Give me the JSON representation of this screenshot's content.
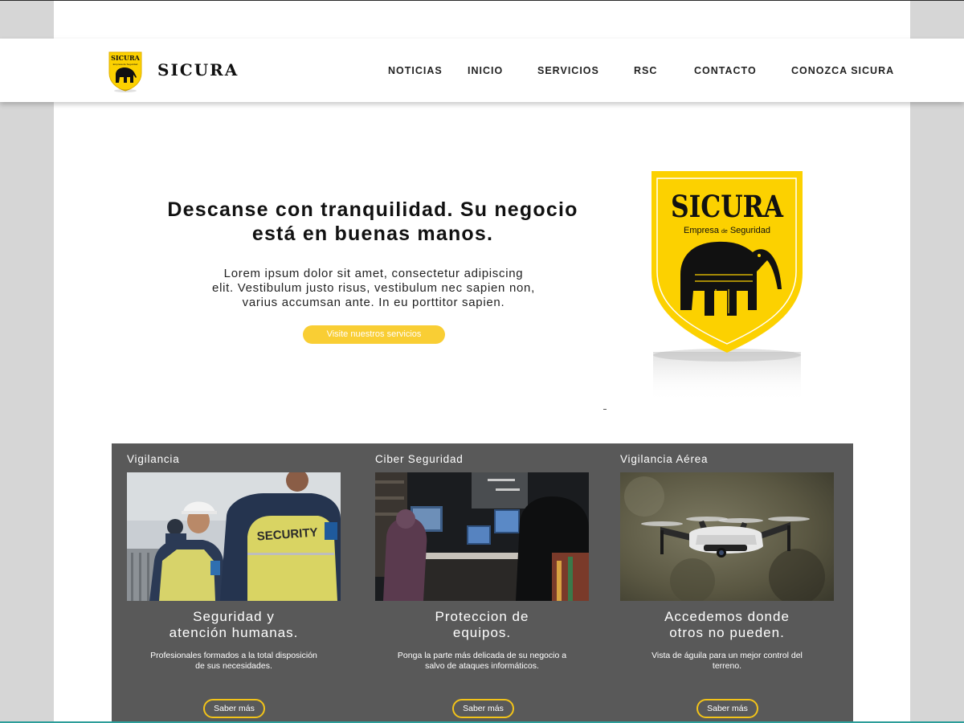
{
  "brand": {
    "name": "SICURA",
    "logo_text": "SICURA",
    "logo_subtext": "Empresa de Seguridad"
  },
  "nav": {
    "items": [
      {
        "label": "NOTICIAS"
      },
      {
        "label": "INICIO"
      },
      {
        "label": "SERVICIOS"
      },
      {
        "label": "RSC"
      },
      {
        "label": "CONTACTO"
      },
      {
        "label": "CONOZCA SICURA"
      }
    ]
  },
  "hero": {
    "title_line1": "Descanse con tranquilidad. Su negocio",
    "title_line2": "está en buenas manos.",
    "text_line1": "Lorem ipsum dolor sit amet, consectetur adipiscing",
    "text_line2": "elit. Vestibulum justo risus, vestibulum nec sapien non,",
    "text_line3": "varius accumsan ante. In eu porttitor sapien.",
    "button_label": "Visite nuestros servicios",
    "shield_title": "SICURA",
    "shield_sub1": "Empresa",
    "shield_sub2": "de",
    "shield_sub3": "Seguridad"
  },
  "services": [
    {
      "title": "Vigilancia",
      "heading_line1": "Seguridad y",
      "heading_line2": "atención humanas.",
      "desc_line1": "Profesionales formados a la total disposición",
      "desc_line2": "de sus necesidades.",
      "button_label": "Saber más",
      "vest_text": "SECURITY"
    },
    {
      "title": "Ciber Seguridad",
      "heading_line1": "Proteccion de",
      "heading_line2": "equipos.",
      "desc_line1": "Ponga la parte más delicada de su negocio a",
      "desc_line2": "salvo de ataques informáticos.",
      "button_label": "Saber más"
    },
    {
      "title": "Vigilancia Aérea",
      "heading_line1": "Accedemos donde",
      "heading_line2": "otros no pueden.",
      "desc_line1": "Vista de águila para un mejor control del",
      "desc_line2": "terreno.",
      "button_label": "Saber más"
    }
  ],
  "colors": {
    "accent": "#f9ce34",
    "shield_yellow": "#fcd100",
    "services_bg": "#595959",
    "page_bg": "#d6d6d6"
  }
}
